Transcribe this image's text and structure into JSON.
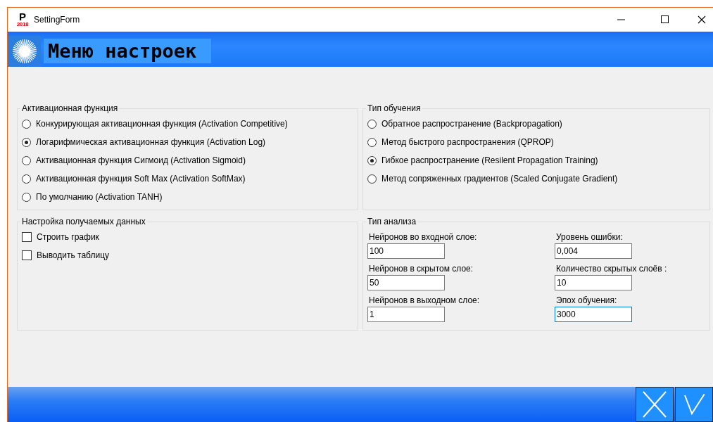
{
  "window": {
    "title": "SettingForm",
    "icon_letter": "P",
    "icon_year": "2018"
  },
  "header": {
    "title": "Меню настроек"
  },
  "activation": {
    "title": "Активационная функция",
    "options": [
      {
        "label": "Конкурирующая активационная функция (Activation Competitive)",
        "selected": false
      },
      {
        "label": "Логарифмическая активационная функция (Activation Log)",
        "selected": true
      },
      {
        "label": "Активационная функция Сигмоид (Activation Sigmoid)",
        "selected": false
      },
      {
        "label": "Активационная функция Soft Max (Activation SoftMax)",
        "selected": false
      },
      {
        "label": "По умолчанию (Activation TANH)",
        "selected": false
      }
    ]
  },
  "training": {
    "title": "Тип обучения",
    "options": [
      {
        "label": "Обратное распространение (Backpropagation)",
        "selected": false
      },
      {
        "label": "Метод быстрого распространения (QPROP)",
        "selected": false
      },
      {
        "label": "Гибкое распространение (Resilent Propagation Training)",
        "selected": true
      },
      {
        "label": "Метод сопряженных градиентов (Scaled Conjugate Gradient)",
        "selected": false
      }
    ]
  },
  "output": {
    "title": "Настройка получаемых данных",
    "options": [
      {
        "label": "Строить график",
        "checked": false
      },
      {
        "label": "Выводить таблицу",
        "checked": false
      }
    ]
  },
  "analysis": {
    "title": "Тип анализа",
    "fields": [
      {
        "label": "Нейронов во входной слое:",
        "value": "100",
        "focused": false
      },
      {
        "label": "Уровень ошибки:",
        "value": "0,004",
        "focused": false
      },
      {
        "label": "Нейронов в скрытом слое:",
        "value": "50",
        "focused": false
      },
      {
        "label": "Количество скрытых слоёв :",
        "value": "10",
        "focused": false
      },
      {
        "label": "Нейронов в выходном слое:",
        "value": "1",
        "focused": false
      },
      {
        "label": "Эпох обучения:",
        "value": "3000",
        "focused": true
      }
    ]
  }
}
